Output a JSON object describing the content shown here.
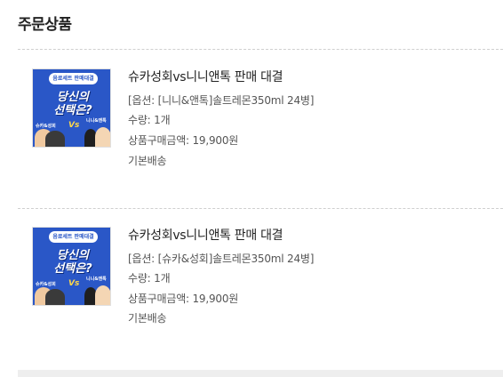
{
  "section": {
    "title": "주문상품"
  },
  "product_image": {
    "tag": "음료세트 판매대결",
    "headline_line1": "당신의",
    "headline_line2": "선택은?",
    "left_brand": "슈카&성회",
    "vs": "Vs",
    "right_brand": "니니&앤톡"
  },
  "items": [
    {
      "name": "슈카성회vs니니앤톡 판매 대결",
      "option": "[옵션: [니니&앤톡]솔트레몬350ml 24병]",
      "quantity": "수량: 1개",
      "price": "상품구매금액: 19,900원",
      "shipping": "기본배송"
    },
    {
      "name": "슈카성회vs니니앤톡 판매 대결",
      "option": "[옵션: [슈카&성회]솔트레몬350ml 24병]",
      "quantity": "수량: 1개",
      "price": "상품구매금액: 19,900원",
      "shipping": "기본배송"
    }
  ],
  "colors": {
    "image_background": "#2a57c7",
    "divider": "#cfcfcf",
    "text_primary": "#222222",
    "text_secondary": "#555555"
  }
}
